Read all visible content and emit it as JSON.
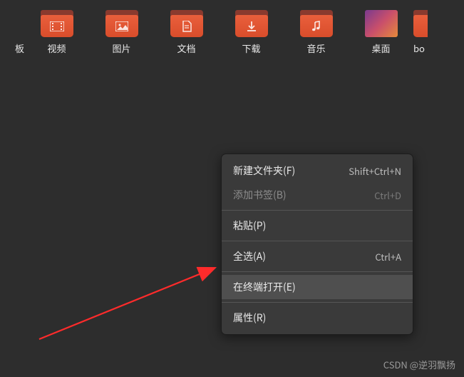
{
  "icons": [
    {
      "id": "templates-partial",
      "label": "板",
      "glyph": "",
      "partial": "left"
    },
    {
      "id": "videos",
      "label": "视频",
      "glyph": "video"
    },
    {
      "id": "pictures",
      "label": "图片",
      "glyph": "image"
    },
    {
      "id": "documents",
      "label": "文档",
      "glyph": "doc"
    },
    {
      "id": "downloads",
      "label": "下载",
      "glyph": "download"
    },
    {
      "id": "music",
      "label": "音乐",
      "glyph": "music"
    },
    {
      "id": "desktop",
      "label": "桌面",
      "glyph": "desktop"
    },
    {
      "id": "bookmarks-partial",
      "label": "bo",
      "glyph": "",
      "partial": "right"
    }
  ],
  "context_menu": {
    "items": [
      {
        "id": "new-folder",
        "label": "新建文件夹(F)",
        "shortcut": "Shift+Ctrl+N",
        "disabled": false
      },
      {
        "id": "add-bookmark",
        "label": "添加书签(B)",
        "shortcut": "Ctrl+D",
        "disabled": true
      },
      {
        "sep": true
      },
      {
        "id": "paste",
        "label": "粘贴(P)",
        "shortcut": "",
        "disabled": false
      },
      {
        "sep": true
      },
      {
        "id": "select-all",
        "label": "全选(A)",
        "shortcut": "Ctrl+A",
        "disabled": false
      },
      {
        "sep": true
      },
      {
        "id": "open-terminal",
        "label": "在终端打开(E)",
        "shortcut": "",
        "disabled": false,
        "hover": true
      },
      {
        "sep": true
      },
      {
        "id": "properties",
        "label": "属性(R)",
        "shortcut": "",
        "disabled": false
      }
    ]
  },
  "watermark": "CSDN @逆羽飘扬",
  "colors": {
    "bg": "#2d2d2d",
    "menu_bg": "#3a3a3a",
    "accent": "#e95f3c",
    "arrow": "#ff2b2b"
  }
}
